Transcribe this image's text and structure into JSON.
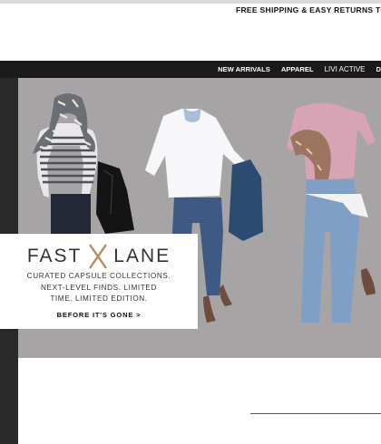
{
  "promo_banner": "FREE SHIPPING & EASY RETURNS TO STO",
  "nav": {
    "items": [
      "NEW ARRIVALS",
      "APPAREL",
      "LIVI ACTIVE",
      "D"
    ]
  },
  "hero_card": {
    "logo_left": "FAST",
    "logo_right": "LANE",
    "desc_line1": "CURATED CAPSULE COLLECTIONS.",
    "desc_line2": "NEXT-LEVEL FINDS. LIMITED",
    "desc_line3": "TIME. LIMITED EDITION.",
    "cta": "BEFORE IT'S GONE >"
  },
  "colors": {
    "navbar": "#1a1a1a",
    "hero_bg": "#a6a4a5",
    "logo_x": "#b98a55"
  }
}
